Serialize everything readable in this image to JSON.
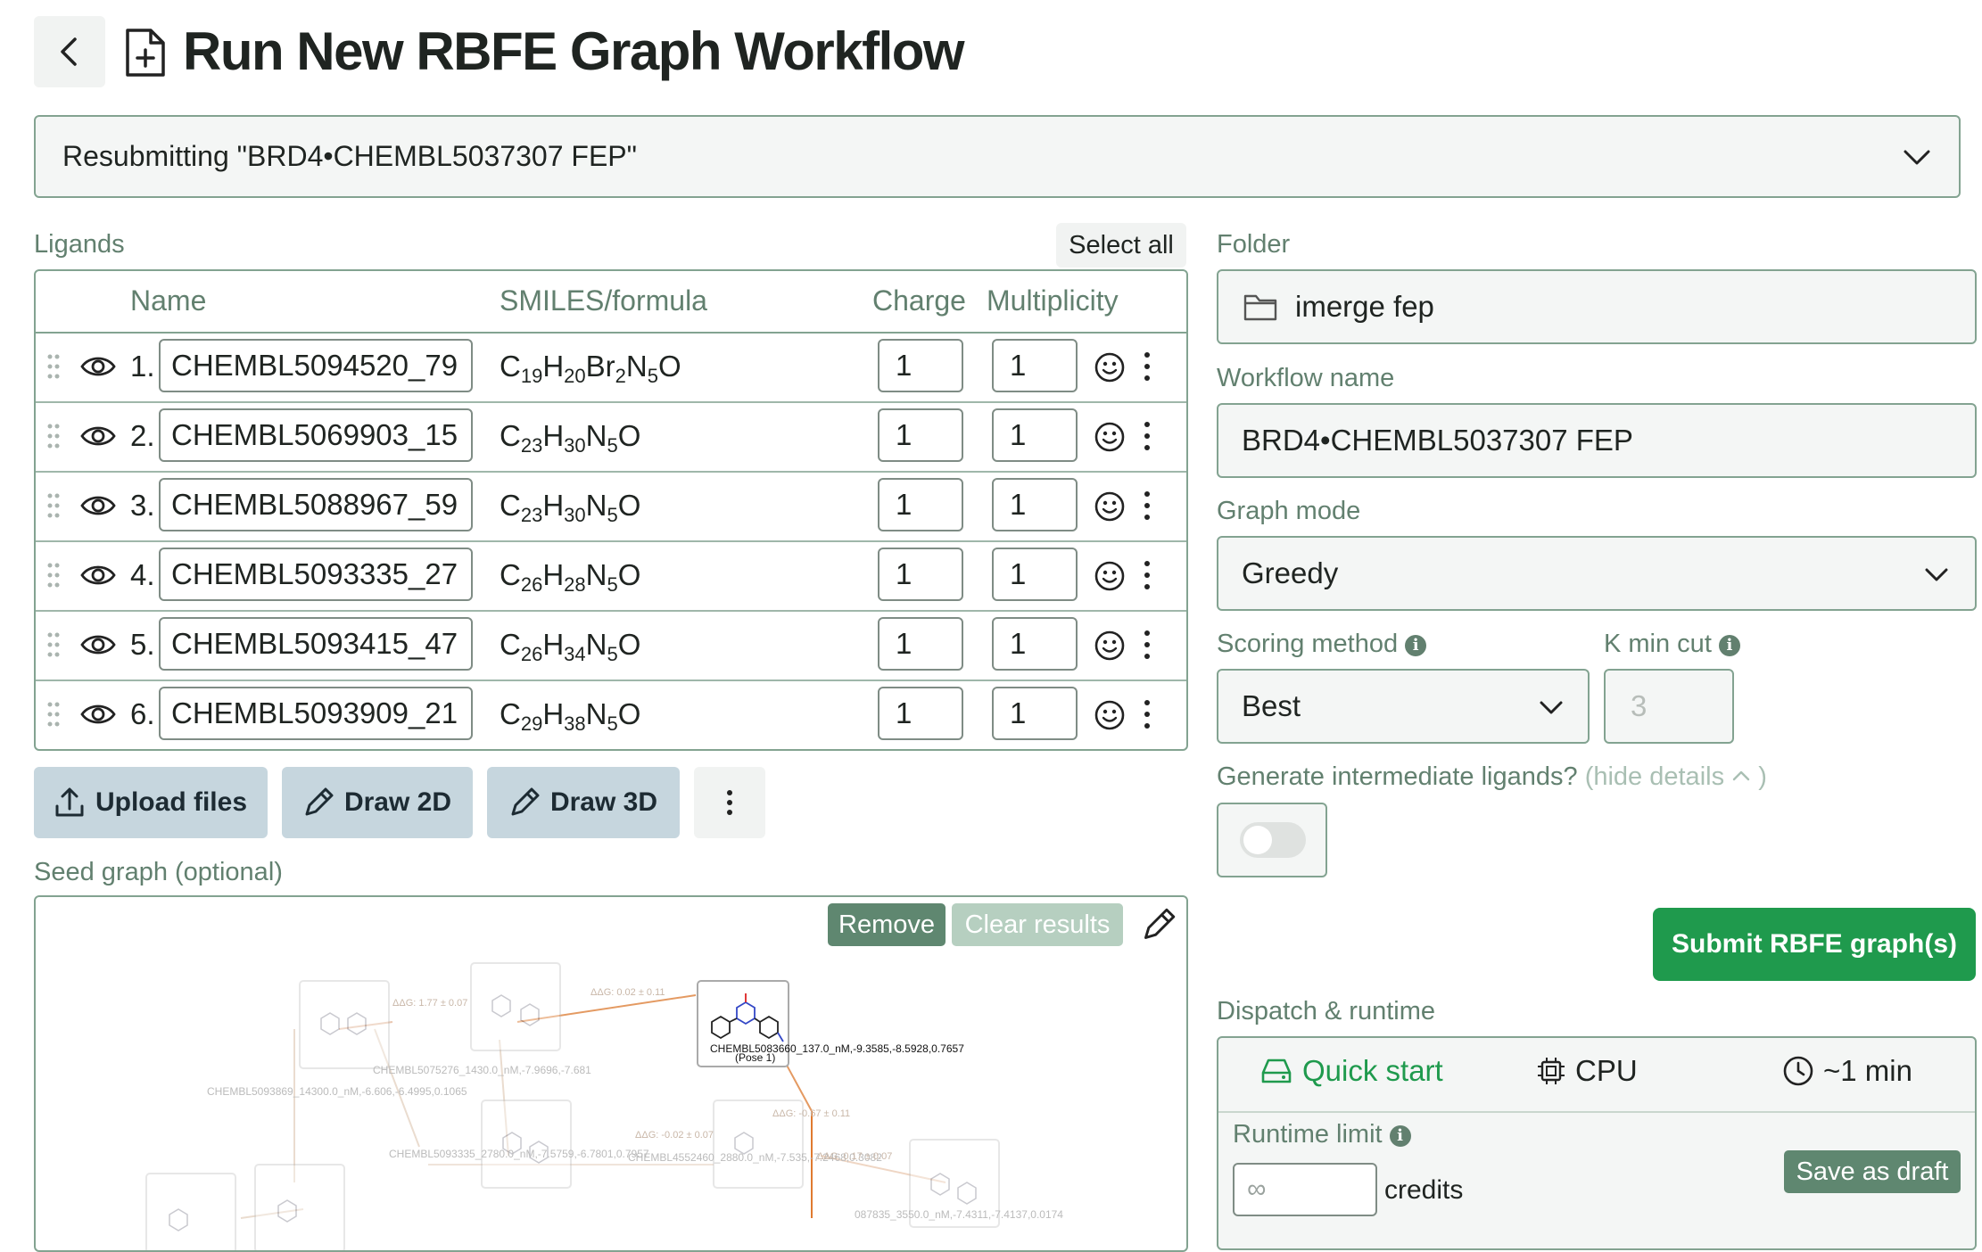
{
  "header": {
    "title": "Run New RBFE Graph Workflow"
  },
  "resubmit": {
    "label": "Resubmitting \"BRD4•CHEMBL5037307 FEP\""
  },
  "ligands": {
    "section_label": "Ligands",
    "select_all": "Select all",
    "columns": {
      "name": "Name",
      "smiles": "SMILES/formula",
      "charge": "Charge",
      "multiplicity": "Multiplicity"
    },
    "rows": [
      {
        "index": "1.",
        "name": "CHEMBL5094520_79",
        "formula": [
          [
            "C",
            "19"
          ],
          [
            "H",
            "20"
          ],
          [
            "Br",
            "2"
          ],
          [
            "N",
            "5"
          ],
          [
            "O",
            ""
          ]
        ],
        "charge": "1",
        "multiplicity": "1"
      },
      {
        "index": "2.",
        "name": "CHEMBL5069903_15",
        "formula": [
          [
            "C",
            "23"
          ],
          [
            "H",
            "30"
          ],
          [
            "N",
            "5"
          ],
          [
            "O",
            ""
          ]
        ],
        "charge": "1",
        "multiplicity": "1"
      },
      {
        "index": "3.",
        "name": "CHEMBL5088967_59",
        "formula": [
          [
            "C",
            "23"
          ],
          [
            "H",
            "30"
          ],
          [
            "N",
            "5"
          ],
          [
            "O",
            ""
          ]
        ],
        "charge": "1",
        "multiplicity": "1"
      },
      {
        "index": "4.",
        "name": "CHEMBL5093335_27",
        "formula": [
          [
            "C",
            "26"
          ],
          [
            "H",
            "28"
          ],
          [
            "N",
            "5"
          ],
          [
            "O",
            ""
          ]
        ],
        "charge": "1",
        "multiplicity": "1"
      },
      {
        "index": "5.",
        "name": "CHEMBL5093415_47",
        "formula": [
          [
            "C",
            "26"
          ],
          [
            "H",
            "34"
          ],
          [
            "N",
            "5"
          ],
          [
            "O",
            ""
          ]
        ],
        "charge": "1",
        "multiplicity": "1"
      },
      {
        "index": "6.",
        "name": "CHEMBL5093909_21",
        "formula": [
          [
            "C",
            "29"
          ],
          [
            "H",
            "38"
          ],
          [
            "N",
            "5"
          ],
          [
            "O",
            ""
          ]
        ],
        "charge": "1",
        "multiplicity": "1"
      }
    ],
    "actions": {
      "upload": "Upload files",
      "draw2d": "Draw 2D",
      "draw3d": "Draw 3D"
    }
  },
  "seed_graph": {
    "label": "Seed graph (optional)",
    "remove": "Remove",
    "clear_results": "Clear results",
    "node_labels": [
      "CHEMBL5083660_137.0_nM,-9.3585,-8.5928,0.7657",
      "(Pose 1)",
      "CHEMBL5075276_1430.0_nM,-7.9696,-7.681",
      "CHEMBL5093869_14300.0_nM,-6.606,-6.4995,0.1065",
      "CHEMBL5093335_2780.0_nM,-7.5759,-6.7801,0.7957",
      "CHEMBL4552460_2880.0_nM,-7.535,-7.2468,0.3082",
      "087835_3550.0_nM,-7.4311,-7.4137,0.0174"
    ],
    "edge_labels": [
      "ΔΔG: 1.77 ± 0.07",
      "ΔΔG: 0.02 ± 0.11",
      "ΔΔG: -0.02 ± 0.07",
      "ΔΔG: 0.17 ± 0.07",
      "ΔΔG: -0.67 ± 0.11"
    ]
  },
  "folder": {
    "label": "Folder",
    "value": "imerge fep"
  },
  "workflow_name": {
    "label": "Workflow name",
    "value": "BRD4•CHEMBL5037307 FEP"
  },
  "graph_mode": {
    "label": "Graph mode",
    "value": "Greedy"
  },
  "scoring": {
    "label": "Scoring method",
    "value": "Best"
  },
  "kmin": {
    "label": "K min cut",
    "value": "3"
  },
  "intermediate": {
    "label": "Generate intermediate ligands?",
    "hide": "(hide details",
    "close_paren": ")",
    "enabled": false
  },
  "submit": "Submit RBFE graph(s)",
  "dispatch": {
    "label": "Dispatch & runtime",
    "quick_start": "Quick start",
    "cpu": "CPU",
    "time": "~1 min",
    "runtime_label": "Runtime limit",
    "runtime_value": "∞",
    "credits": "credits",
    "save_draft": "Save as draft"
  },
  "colors": {
    "accent_green": "#1f9a4d",
    "border_green": "#83a391",
    "label_green": "#62806f",
    "button_blue": "#c6d6de"
  }
}
